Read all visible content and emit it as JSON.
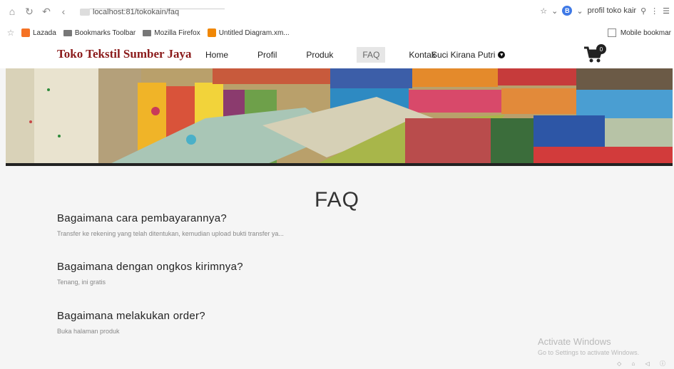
{
  "browser": {
    "url": "localhost:81/tokokain/faq",
    "search_text": "profil toko kair",
    "bookmarks": [
      "Lazada",
      "Bookmarks Toolbar",
      "Mozilla Firefox",
      "Untitled Diagram.xm..."
    ],
    "mobile_bookmarks": "Mobile bookmar"
  },
  "site": {
    "brand": "Toko Tekstil Sumber Jaya",
    "menu": [
      "Home",
      "Profil",
      "Produk",
      "FAQ",
      "Kontak"
    ],
    "user": "Suci Kirana Putri",
    "cart_count": "0"
  },
  "faq": {
    "title": "FAQ",
    "items": [
      {
        "q": "Bagaimana cara pembayarannya?",
        "a": "Transfer ke rekening yang telah ditentukan, kemudian upload bukti transfer ya..."
      },
      {
        "q": "Bagaimana dengan ongkos kirimnya?",
        "a": "Tenang, ini gratis"
      },
      {
        "q": "Bagaimana melakukan order?",
        "a": "Buka halaman produk"
      }
    ]
  },
  "watermark": {
    "line1": "Activate Windows",
    "line2": "Go to Settings to activate Windows."
  },
  "colors": {
    "brand": "#8b1a1a",
    "active_menu_bg": "#e6e6e6"
  }
}
